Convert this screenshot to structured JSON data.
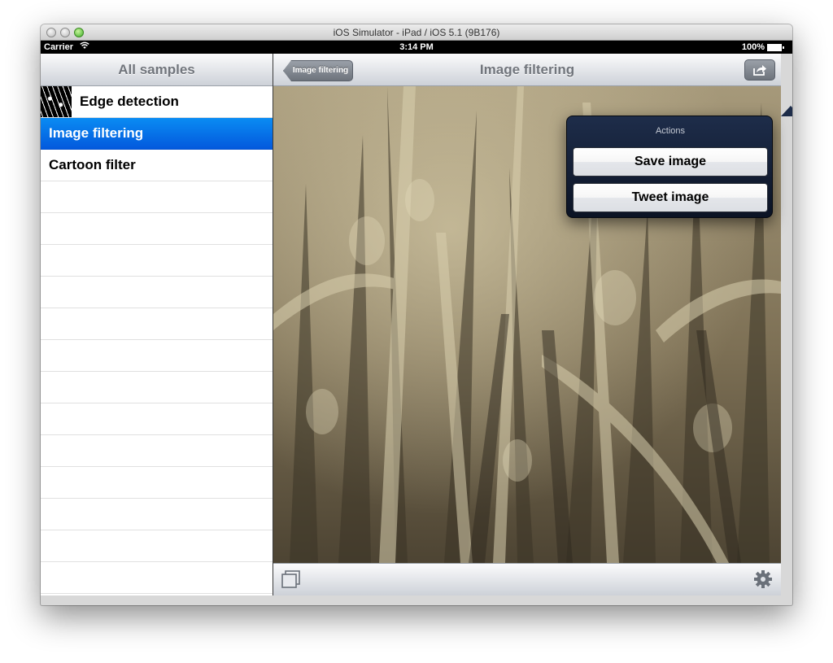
{
  "window": {
    "title": "iOS Simulator - iPad / iOS 5.1 (9B176)"
  },
  "status_bar": {
    "carrier": "Carrier",
    "time": "3:14 PM",
    "battery": "100%"
  },
  "master": {
    "title": "All samples",
    "items": [
      {
        "label": "Edge detection",
        "selected": false,
        "has_thumbnail": true
      },
      {
        "label": "Image filtering",
        "selected": true,
        "has_thumbnail": false
      },
      {
        "label": "Cartoon filter",
        "selected": false,
        "has_thumbnail": false
      }
    ]
  },
  "detail": {
    "title": "Image filtering",
    "back_button": "Image filtering"
  },
  "popover": {
    "title": "Actions",
    "buttons": [
      "Save image",
      "Tweet image"
    ]
  },
  "colors": {
    "selection": "#0a74ee",
    "popover": "#14203a",
    "sepia": "#7e7056"
  }
}
